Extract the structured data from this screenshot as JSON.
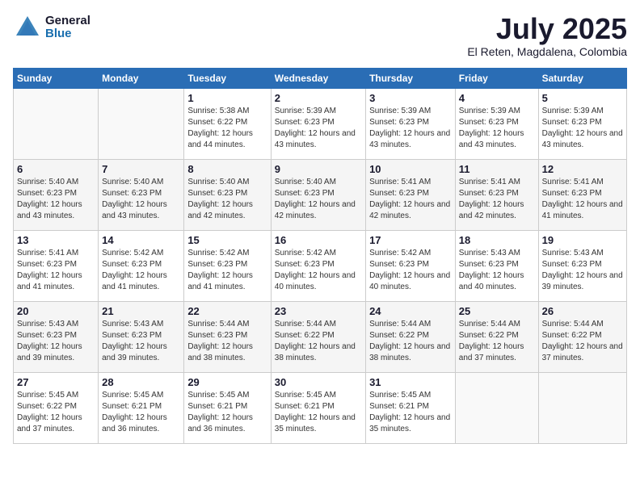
{
  "logo": {
    "general": "General",
    "blue": "Blue"
  },
  "title": {
    "month_year": "July 2025",
    "location": "El Reten, Magdalena, Colombia"
  },
  "weekdays": [
    "Sunday",
    "Monday",
    "Tuesday",
    "Wednesday",
    "Thursday",
    "Friday",
    "Saturday"
  ],
  "weeks": [
    [
      {
        "day": "",
        "sunrise": "",
        "sunset": "",
        "daylight": ""
      },
      {
        "day": "",
        "sunrise": "",
        "sunset": "",
        "daylight": ""
      },
      {
        "day": "1",
        "sunrise": "Sunrise: 5:38 AM",
        "sunset": "Sunset: 6:22 PM",
        "daylight": "Daylight: 12 hours and 44 minutes."
      },
      {
        "day": "2",
        "sunrise": "Sunrise: 5:39 AM",
        "sunset": "Sunset: 6:23 PM",
        "daylight": "Daylight: 12 hours and 43 minutes."
      },
      {
        "day": "3",
        "sunrise": "Sunrise: 5:39 AM",
        "sunset": "Sunset: 6:23 PM",
        "daylight": "Daylight: 12 hours and 43 minutes."
      },
      {
        "day": "4",
        "sunrise": "Sunrise: 5:39 AM",
        "sunset": "Sunset: 6:23 PM",
        "daylight": "Daylight: 12 hours and 43 minutes."
      },
      {
        "day": "5",
        "sunrise": "Sunrise: 5:39 AM",
        "sunset": "Sunset: 6:23 PM",
        "daylight": "Daylight: 12 hours and 43 minutes."
      }
    ],
    [
      {
        "day": "6",
        "sunrise": "Sunrise: 5:40 AM",
        "sunset": "Sunset: 6:23 PM",
        "daylight": "Daylight: 12 hours and 43 minutes."
      },
      {
        "day": "7",
        "sunrise": "Sunrise: 5:40 AM",
        "sunset": "Sunset: 6:23 PM",
        "daylight": "Daylight: 12 hours and 43 minutes."
      },
      {
        "day": "8",
        "sunrise": "Sunrise: 5:40 AM",
        "sunset": "Sunset: 6:23 PM",
        "daylight": "Daylight: 12 hours and 42 minutes."
      },
      {
        "day": "9",
        "sunrise": "Sunrise: 5:40 AM",
        "sunset": "Sunset: 6:23 PM",
        "daylight": "Daylight: 12 hours and 42 minutes."
      },
      {
        "day": "10",
        "sunrise": "Sunrise: 5:41 AM",
        "sunset": "Sunset: 6:23 PM",
        "daylight": "Daylight: 12 hours and 42 minutes."
      },
      {
        "day": "11",
        "sunrise": "Sunrise: 5:41 AM",
        "sunset": "Sunset: 6:23 PM",
        "daylight": "Daylight: 12 hours and 42 minutes."
      },
      {
        "day": "12",
        "sunrise": "Sunrise: 5:41 AM",
        "sunset": "Sunset: 6:23 PM",
        "daylight": "Daylight: 12 hours and 41 minutes."
      }
    ],
    [
      {
        "day": "13",
        "sunrise": "Sunrise: 5:41 AM",
        "sunset": "Sunset: 6:23 PM",
        "daylight": "Daylight: 12 hours and 41 minutes."
      },
      {
        "day": "14",
        "sunrise": "Sunrise: 5:42 AM",
        "sunset": "Sunset: 6:23 PM",
        "daylight": "Daylight: 12 hours and 41 minutes."
      },
      {
        "day": "15",
        "sunrise": "Sunrise: 5:42 AM",
        "sunset": "Sunset: 6:23 PM",
        "daylight": "Daylight: 12 hours and 41 minutes."
      },
      {
        "day": "16",
        "sunrise": "Sunrise: 5:42 AM",
        "sunset": "Sunset: 6:23 PM",
        "daylight": "Daylight: 12 hours and 40 minutes."
      },
      {
        "day": "17",
        "sunrise": "Sunrise: 5:42 AM",
        "sunset": "Sunset: 6:23 PM",
        "daylight": "Daylight: 12 hours and 40 minutes."
      },
      {
        "day": "18",
        "sunrise": "Sunrise: 5:43 AM",
        "sunset": "Sunset: 6:23 PM",
        "daylight": "Daylight: 12 hours and 40 minutes."
      },
      {
        "day": "19",
        "sunrise": "Sunrise: 5:43 AM",
        "sunset": "Sunset: 6:23 PM",
        "daylight": "Daylight: 12 hours and 39 minutes."
      }
    ],
    [
      {
        "day": "20",
        "sunrise": "Sunrise: 5:43 AM",
        "sunset": "Sunset: 6:23 PM",
        "daylight": "Daylight: 12 hours and 39 minutes."
      },
      {
        "day": "21",
        "sunrise": "Sunrise: 5:43 AM",
        "sunset": "Sunset: 6:23 PM",
        "daylight": "Daylight: 12 hours and 39 minutes."
      },
      {
        "day": "22",
        "sunrise": "Sunrise: 5:44 AM",
        "sunset": "Sunset: 6:23 PM",
        "daylight": "Daylight: 12 hours and 38 minutes."
      },
      {
        "day": "23",
        "sunrise": "Sunrise: 5:44 AM",
        "sunset": "Sunset: 6:22 PM",
        "daylight": "Daylight: 12 hours and 38 minutes."
      },
      {
        "day": "24",
        "sunrise": "Sunrise: 5:44 AM",
        "sunset": "Sunset: 6:22 PM",
        "daylight": "Daylight: 12 hours and 38 minutes."
      },
      {
        "day": "25",
        "sunrise": "Sunrise: 5:44 AM",
        "sunset": "Sunset: 6:22 PM",
        "daylight": "Daylight: 12 hours and 37 minutes."
      },
      {
        "day": "26",
        "sunrise": "Sunrise: 5:44 AM",
        "sunset": "Sunset: 6:22 PM",
        "daylight": "Daylight: 12 hours and 37 minutes."
      }
    ],
    [
      {
        "day": "27",
        "sunrise": "Sunrise: 5:45 AM",
        "sunset": "Sunset: 6:22 PM",
        "daylight": "Daylight: 12 hours and 37 minutes."
      },
      {
        "day": "28",
        "sunrise": "Sunrise: 5:45 AM",
        "sunset": "Sunset: 6:21 PM",
        "daylight": "Daylight: 12 hours and 36 minutes."
      },
      {
        "day": "29",
        "sunrise": "Sunrise: 5:45 AM",
        "sunset": "Sunset: 6:21 PM",
        "daylight": "Daylight: 12 hours and 36 minutes."
      },
      {
        "day": "30",
        "sunrise": "Sunrise: 5:45 AM",
        "sunset": "Sunset: 6:21 PM",
        "daylight": "Daylight: 12 hours and 35 minutes."
      },
      {
        "day": "31",
        "sunrise": "Sunrise: 5:45 AM",
        "sunset": "Sunset: 6:21 PM",
        "daylight": "Daylight: 12 hours and 35 minutes."
      },
      {
        "day": "",
        "sunrise": "",
        "sunset": "",
        "daylight": ""
      },
      {
        "day": "",
        "sunrise": "",
        "sunset": "",
        "daylight": ""
      }
    ]
  ]
}
